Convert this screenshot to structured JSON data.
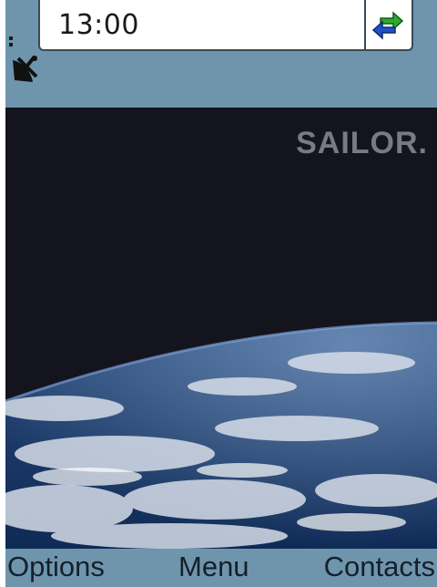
{
  "status": {
    "time": "13:00"
  },
  "icons": {
    "signal": "signal-strength-icon",
    "satellite": "satellite-dish-icon",
    "connection": "sync-arrows-icon"
  },
  "wallpaper": {
    "brand": "SAILOR."
  },
  "softkeys": {
    "left": "Options",
    "middle": "Menu",
    "right": "Contacts"
  },
  "colors": {
    "bar": "#6f95ad",
    "space": "#14141e",
    "arrow_green": "#2eaa2e",
    "arrow_blue": "#1e50c8"
  }
}
